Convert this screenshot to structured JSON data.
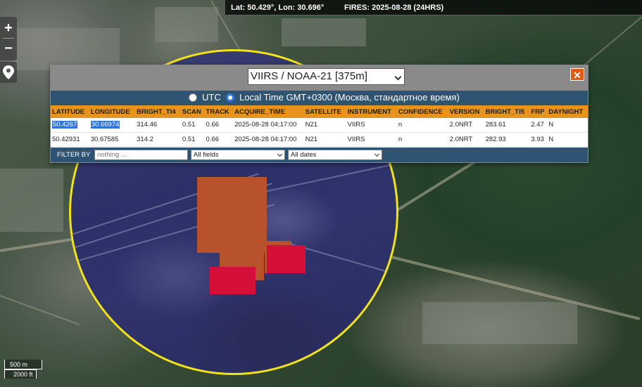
{
  "topbar": {
    "coords": "Lat: 50.429°, Lon: 30.696°",
    "fires": "FIRES: 2025-08-28 (24HRS)"
  },
  "controls": {
    "zoom_in": "+",
    "zoom_out": "−",
    "locate_icon": "map-pin-icon"
  },
  "scale": {
    "metric": "500 m",
    "imperial": "2000 ft"
  },
  "popup": {
    "layer": "VIIRS / NOAA-21 [375m]",
    "close": "✕",
    "time_utc": "UTC",
    "time_local": "Local Time GMT+0300 (Москва, стандартное время)",
    "time_selected": "local",
    "columns": [
      "LATITUDE",
      "LONGITUDE",
      "BRIGHT_TI4",
      "SCAN",
      "TRACK",
      "ACQUIRE_TIME",
      "SATELLITE",
      "INSTRUMENT",
      "CONFIDENCE",
      "VERSION",
      "BRIGHT_TI5",
      "FRP",
      "DAYNIGHT"
    ],
    "rows": [
      [
        "50.4267",
        "30.66974",
        "314.46",
        "0.51",
        "0.66",
        "2025-08-28 04:17:00",
        "N21",
        "VIIRS",
        "n",
        "2.0NRT",
        "283.61",
        "2.47",
        "N"
      ],
      [
        "50.42931",
        "30.67585",
        "314.2",
        "0.51",
        "0.66",
        "2025-08-28 04:17:00",
        "N21",
        "VIIRS",
        "n",
        "2.0NRT",
        "282.93",
        "3.93",
        "N"
      ]
    ],
    "selected_row": 0,
    "filter": {
      "label": "FILTER BY",
      "placeholder": "nothing ...",
      "fields": "All fields",
      "dates": "All dates"
    }
  },
  "colors": {
    "circle": "#f2e318",
    "fire_old": "#b8522c",
    "fire_new": "#d4103a",
    "header": "#e8941c",
    "bar": "#2f5372"
  }
}
